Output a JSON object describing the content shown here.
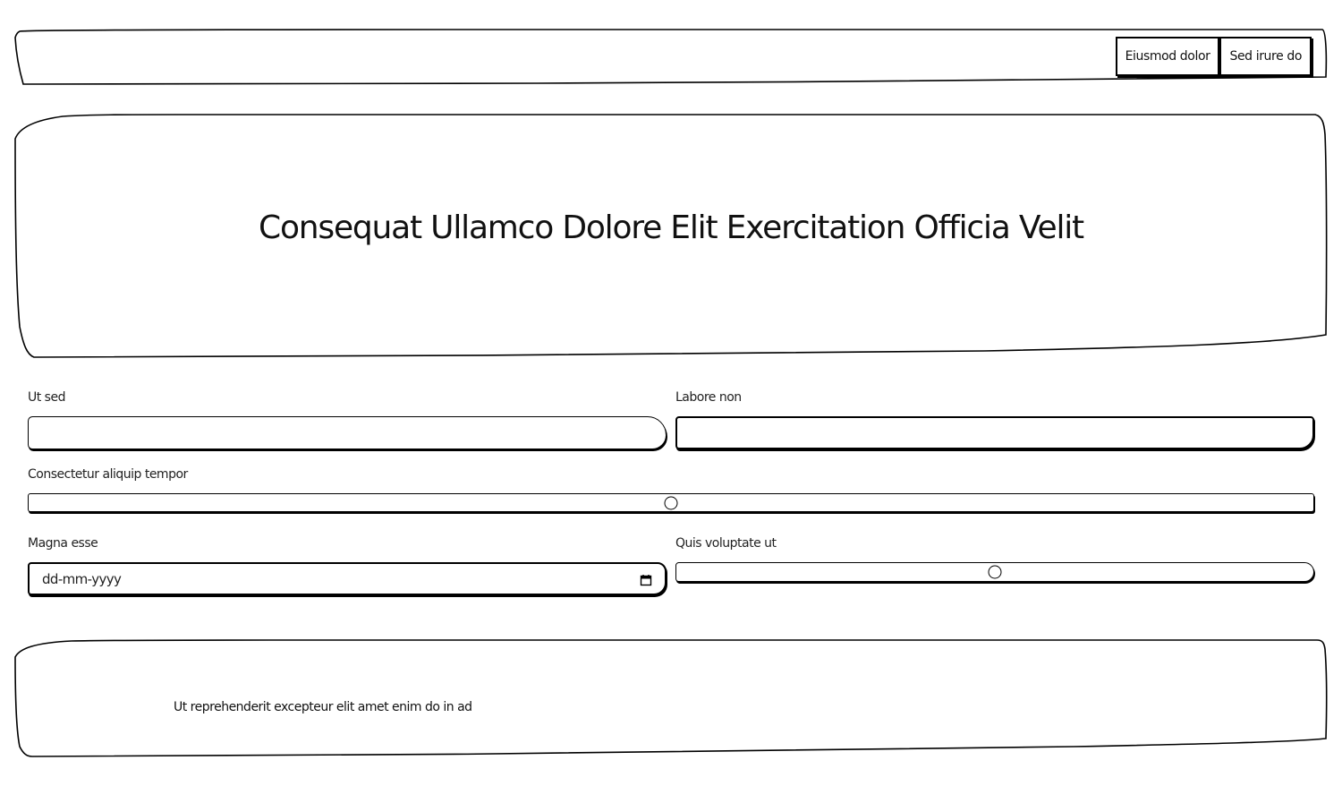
{
  "nav": {
    "buttons": [
      "Eiusmod dolor",
      "Sed irure do"
    ]
  },
  "hero": {
    "title": "Consequat Ullamco Dolore Elit Exercitation Officia Velit"
  },
  "form": {
    "field_a_label": "Ut sed",
    "field_a_value": "",
    "field_b_label": "Labore non",
    "field_b_value": "",
    "slider_a_label": "Consectetur aliquip tempor",
    "slider_a_value": 0.5,
    "date_label": "Magna esse",
    "date_placeholder": "dd-mm-yyyy",
    "slider_b_label": "Quis voluptate ut",
    "slider_b_value": 0.5
  },
  "footer": {
    "text": "Ut reprehenderit excepteur elit amet enim do in ad"
  },
  "icons": {
    "date": "calendar-icon"
  }
}
